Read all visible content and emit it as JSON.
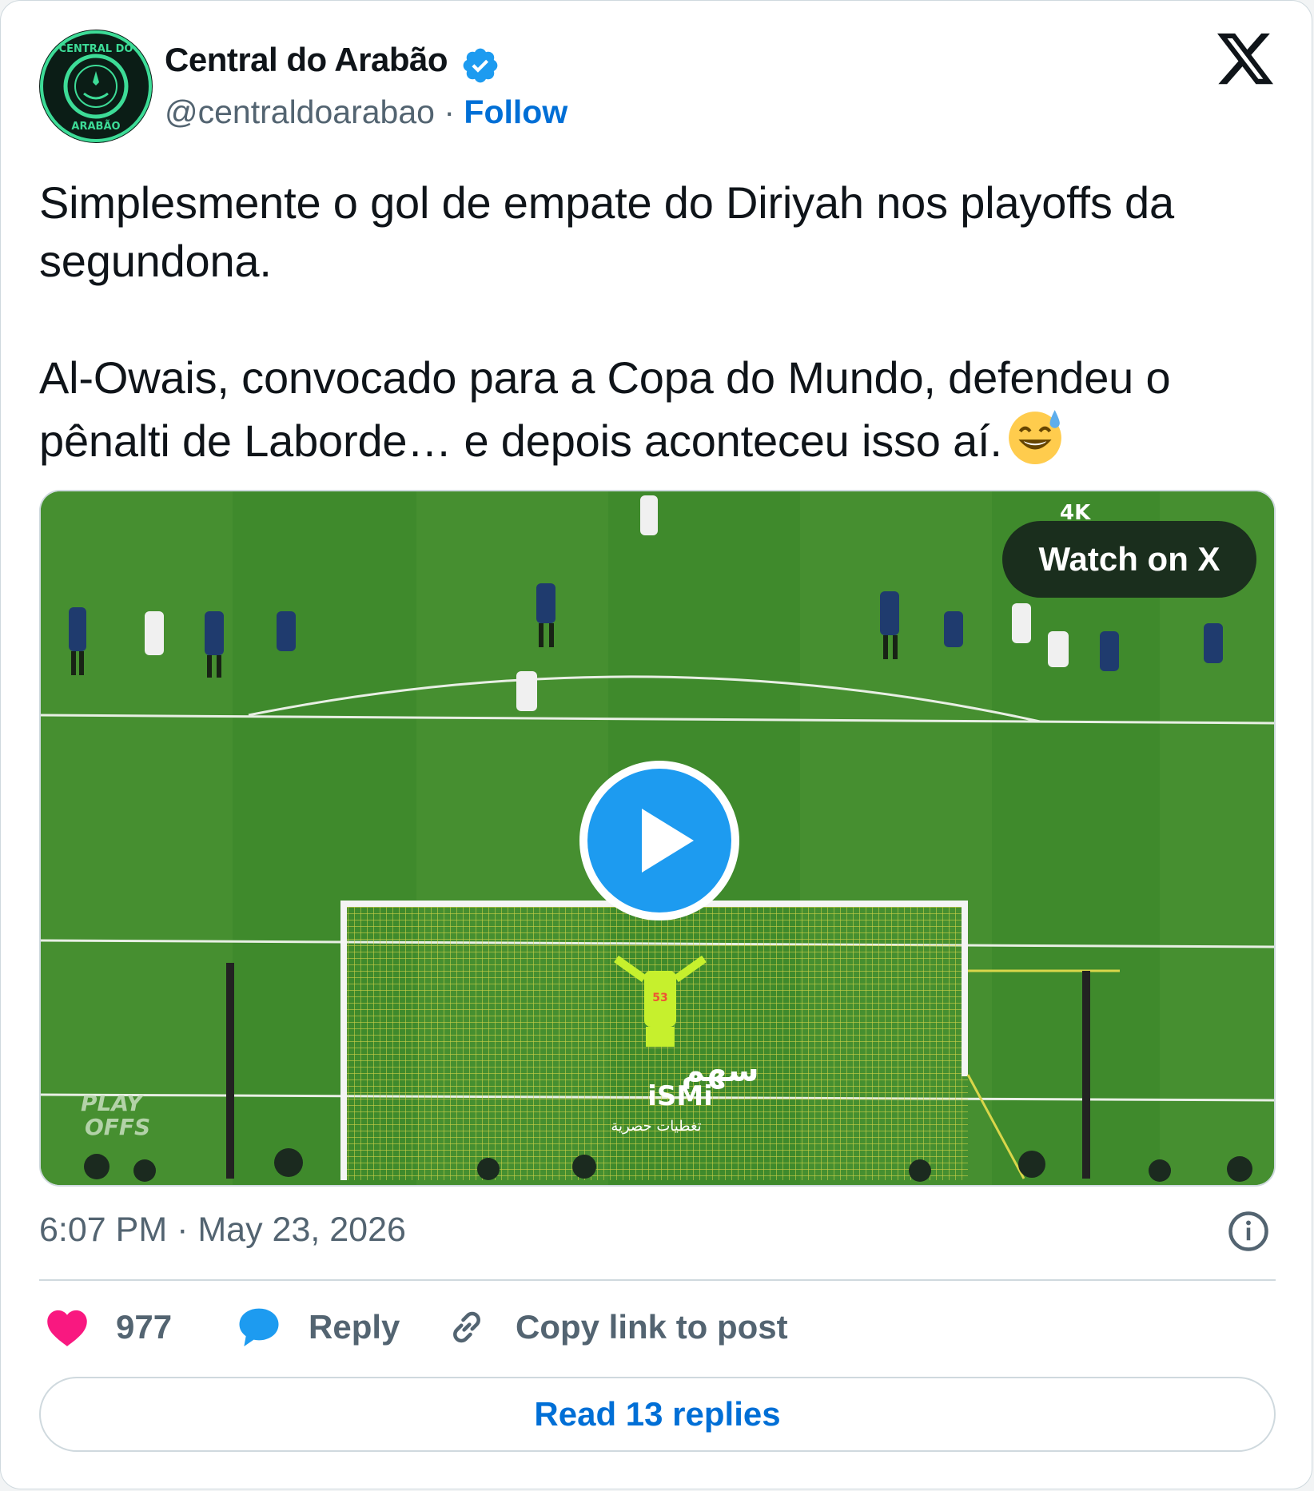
{
  "author": {
    "name": "Central do Arabão",
    "handle": "@centraldoarabao",
    "separator": "·",
    "follow_label": "Follow",
    "avatar_text_top": "CENTRAL DO",
    "avatar_text_bottom": "ARABÃO"
  },
  "tweet": {
    "text": "Simplesmente o gol de empate do Diriyah nos playoffs da segundona.\n\nAl-Owais, convocado para a Copa do Mundo, defendeu o pênalti de Laborde… e depois aconteceu isso aí.",
    "emoji": "sweat-smile-emoji"
  },
  "media": {
    "watch_label": "Watch on X",
    "badge": "4K",
    "watermark_arabic": "سهم",
    "watermark_latin": "iSMi",
    "watermark_sub": "تغطيات حصرية",
    "corner_logo_top": "PLAY",
    "corner_logo_bottom": "OFFS",
    "keeper_number": "53"
  },
  "meta": {
    "timestamp": "6:07 PM · May 23, 2026"
  },
  "actions": {
    "likes_count": "977",
    "reply_label": "Reply",
    "copy_label": "Copy link to post",
    "read_replies_label": "Read 13 replies"
  },
  "colors": {
    "accent_blue": "#1d9bf0",
    "link_blue": "#006fd6",
    "heart_pink": "#f91880",
    "muted_text": "#536471",
    "field_green": "#3f8a2c"
  },
  "icons": [
    "verified-badge-icon",
    "x-logo-icon",
    "play-icon",
    "info-icon",
    "heart-icon",
    "speech-bubble-icon",
    "link-icon"
  ]
}
